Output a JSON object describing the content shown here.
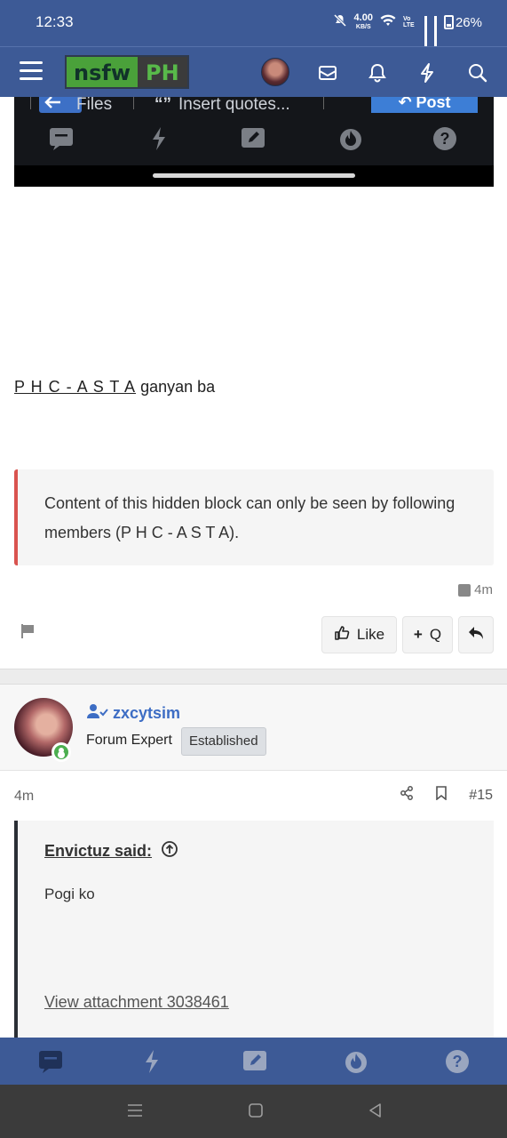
{
  "status_bar": {
    "time": "12:33",
    "net_speed": "4.00",
    "net_unit": "KB/S",
    "volte": "Vo LTE",
    "battery": "26%"
  },
  "header": {
    "logo_left": "nsfw",
    "logo_right": "PH",
    "icons": [
      "menu-icon",
      "avatar",
      "mail-icon",
      "bell-icon",
      "bolt-icon",
      "search-icon"
    ]
  },
  "embed": {
    "files_label": "Files",
    "quotes_label": "Insert quotes...",
    "post_label": "Post",
    "icons": [
      "chat-icon",
      "bolt-icon",
      "edit-icon",
      "fire-icon",
      "help-icon"
    ]
  },
  "post": {
    "mention": "P H C - A S T A",
    "text": " ganyan ba",
    "hidden_block": "Content of this hidden block can only be seen by following members (P H C - A S T A).",
    "edited_time": "4m",
    "actions": {
      "like": "Like",
      "quote": "Q",
      "quote_prefix": "+"
    }
  },
  "next_post": {
    "username": "zxcytsim",
    "user_title": "Forum Expert",
    "badge": "Established",
    "time": "4m",
    "post_number": "#15",
    "quote": {
      "author": "Envictuz said:",
      "body": "Pogi ko",
      "attachment": "View attachment 3038461"
    }
  },
  "bottom_nav": {
    "icons": [
      "chat-icon",
      "bolt-icon",
      "edit-icon",
      "fire-icon",
      "help-icon"
    ]
  },
  "colors": {
    "header": "#3d5a96",
    "accent_link": "#3d6dc4",
    "hidden_border": "#d9534f",
    "online": "#4caf50"
  }
}
